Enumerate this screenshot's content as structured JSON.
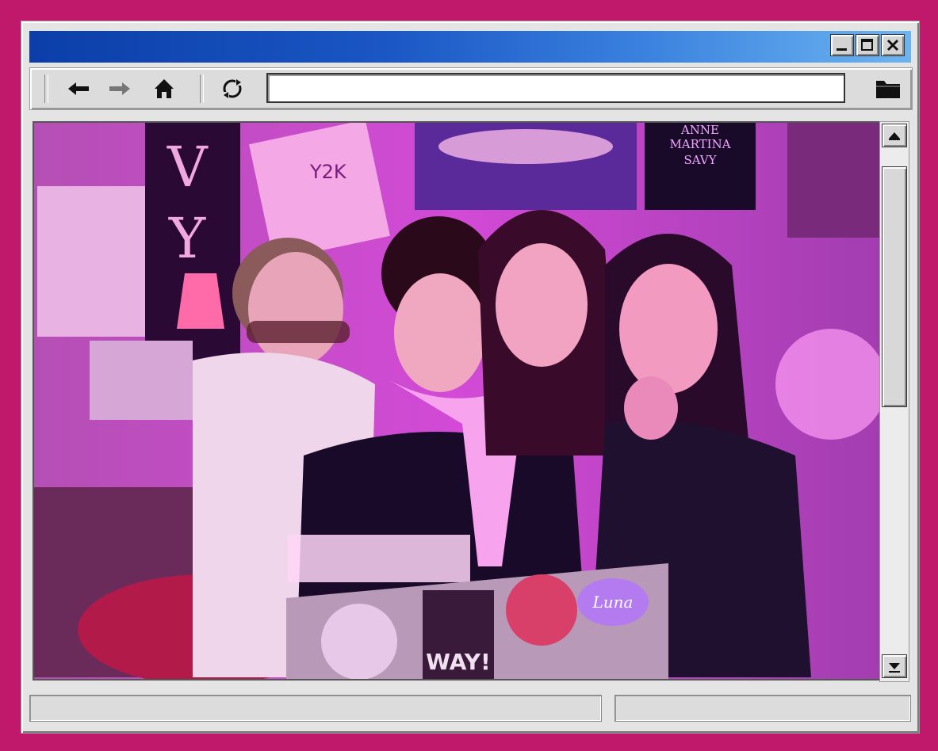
{
  "window": {
    "title": "",
    "controls": {
      "minimize": "minimize",
      "maximize": "maximize",
      "close": "close"
    }
  },
  "toolbar": {
    "back_icon": "back-arrow-icon",
    "forward_icon": "forward-arrow-icon",
    "home_icon": "home-icon",
    "refresh_icon": "refresh-icon",
    "address_value": "",
    "folder_icon": "folder-icon"
  },
  "content": {
    "image": "photo of four friends in a pink-lit bedroom looking at a laptop covered with stickers",
    "poster_texts": {
      "poster_top": "ANNE MARTINA SAVY",
      "poster_y2k": "Y2K",
      "banner": "VY",
      "sticker_luna": "Luna",
      "sticker_way": "WAY!"
    }
  },
  "status": {
    "left": "",
    "right": ""
  },
  "colors": {
    "page_background": "#c0196b",
    "titlebar_start": "#0b3ea8",
    "titlebar_end": "#6cb4f0",
    "window_face": "#e4e4e4"
  }
}
